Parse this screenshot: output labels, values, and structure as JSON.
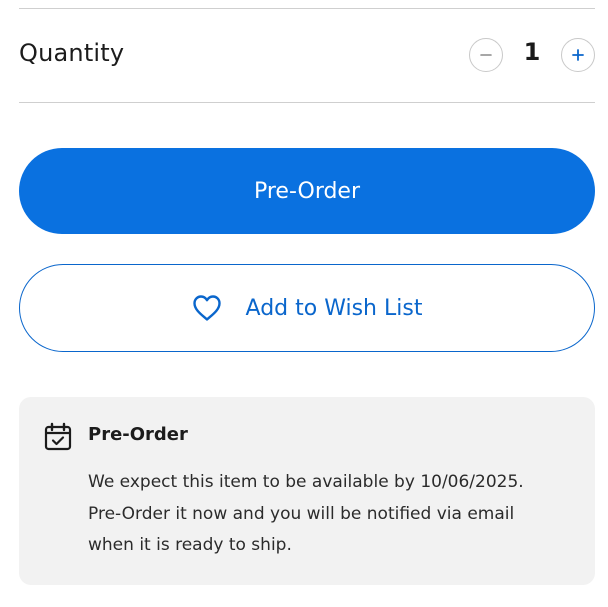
{
  "quantity": {
    "label": "Quantity",
    "value": "1",
    "decrement_icon": "minus-icon",
    "increment_icon": "plus-icon"
  },
  "actions": {
    "preorder_label": "Pre-Order",
    "wishlist_label": "Add to Wish List",
    "wishlist_icon": "heart-icon"
  },
  "notice": {
    "icon": "calendar-check-icon",
    "title": "Pre-Order",
    "line1": "We expect this item to be available by 10/06/2025.",
    "line2": "Pre-Order it now and you will be notified via email",
    "line3": "when it is ready to ship."
  },
  "colors": {
    "primary": "#0a71e0",
    "primary_outline": "#0a66cc",
    "notice_bg": "#f2f2f2",
    "divider": "#cfcfcf"
  }
}
